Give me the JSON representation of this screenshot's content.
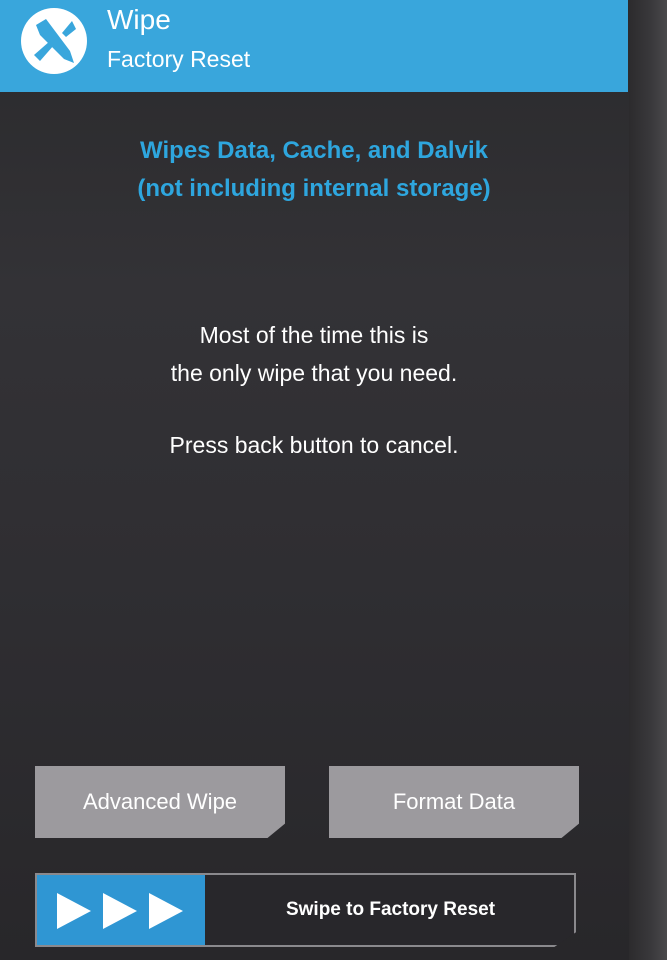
{
  "header": {
    "title": "Wipe",
    "subtitle": "Factory Reset",
    "logo_icon": "twrp-logo-icon",
    "color": "#39a6dc"
  },
  "info": {
    "line1": "Wipes Data, Cache, and Dalvik",
    "line2": "(not including internal storage)",
    "color": "#2ea6de"
  },
  "message": {
    "line1": "Most of the time this is",
    "line2": "the only wipe that you need.",
    "line3": "Press back button to cancel."
  },
  "buttons": {
    "advanced_wipe": "Advanced Wipe",
    "format_data": "Format Data"
  },
  "swipe": {
    "label": "Swipe to Factory Reset",
    "arrows_icon": "triple-play-arrow-icon",
    "handle_color": "#2f96d3"
  }
}
